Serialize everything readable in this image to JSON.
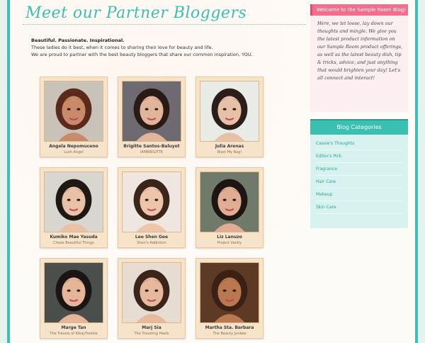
{
  "page": {
    "title": "Meet our Partner Bloggers",
    "intro_lead": "Beautiful. Passionate. Inspirational.",
    "intro_line1": "These ladies do it best, when it comes to sharing their love for beauty and life.",
    "intro_line2": "We are proud to partner with the best beauty bloggers that share our common inspiration, YOU."
  },
  "bloggers": [
    {
      "name": "Angela Nepomuceno",
      "blog": "Lush Angel",
      "photo_icon": "portrait-photo",
      "skin": "#c98a6a",
      "hair": "#5a2a1a",
      "bg": "#c9c2b8"
    },
    {
      "name": "Brigitte Santos-Baluyot",
      "blog": "IAMBRIGITTE",
      "photo_icon": "portrait-photo",
      "skin": "#e2b49a",
      "hair": "#2a1a16",
      "bg": "#6e6a72"
    },
    {
      "name": "Julia Arenas",
      "blog": "Blast My Bag!",
      "photo_icon": "portrait-photo",
      "skin": "#e8c0a8",
      "hair": "#2b1e1a",
      "bg": "#e9ece6"
    },
    {
      "name": "Kumiko Mae Yasuda",
      "blog": "Chase Beautiful Things",
      "photo_icon": "portrait-photo",
      "skin": "#e9c1a6",
      "hair": "#1f1714",
      "bg": "#d9d6d2"
    },
    {
      "name": "Lee Shen Gee",
      "blog": "Shen's Addiction",
      "photo_icon": "portrait-photo",
      "skin": "#eec4aa",
      "hair": "#3a2518",
      "bg": "#efe7df"
    },
    {
      "name": "Liz Lanuzo",
      "blog": "Project Vanity",
      "photo_icon": "portrait-photo",
      "skin": "#e0ad92",
      "hair": "#1c1512",
      "bg": "#6f7a6a"
    },
    {
      "name": "Marge Tan",
      "blog": "The Travels of KikayTrekkie",
      "photo_icon": "portrait-photo",
      "skin": "#e4b598",
      "hair": "#1a1412",
      "bg": "#4a4f4c"
    },
    {
      "name": "Marj Sia",
      "blog": "The Traveling Heels",
      "photo_icon": "portrait-photo",
      "skin": "#e6b89c",
      "hair": "#3b2419",
      "bg": "#e6dcd2"
    },
    {
      "name": "Martha Sta. Barbara",
      "blog": "The Beauty Junkee",
      "photo_icon": "portrait-photo",
      "skin": "#b9784f",
      "hair": "#3a2114",
      "bg": "#5c3a26"
    }
  ],
  "sidebar": {
    "welcome_title": "Welcome to the Sample Room Blog!",
    "welcome_text": "Here, we let loose, lay down our thoughts and mingle. We give you the latest product information on our Sample Room product offerings, as well as the latest beauty dish, tip & tricks, advice, and just anything that would brighten your day! Let's all connect and interact!",
    "categories_title": "Blog Categories",
    "categories": [
      "Cassie's Thoughts",
      "Editor's Pick",
      "Fragrance",
      "Hair Care",
      "Makeup",
      "Skin Care"
    ]
  },
  "colors": {
    "accent": "#3bbfb0",
    "pink": "#ef6f8c",
    "card": "#f7e3c9"
  }
}
